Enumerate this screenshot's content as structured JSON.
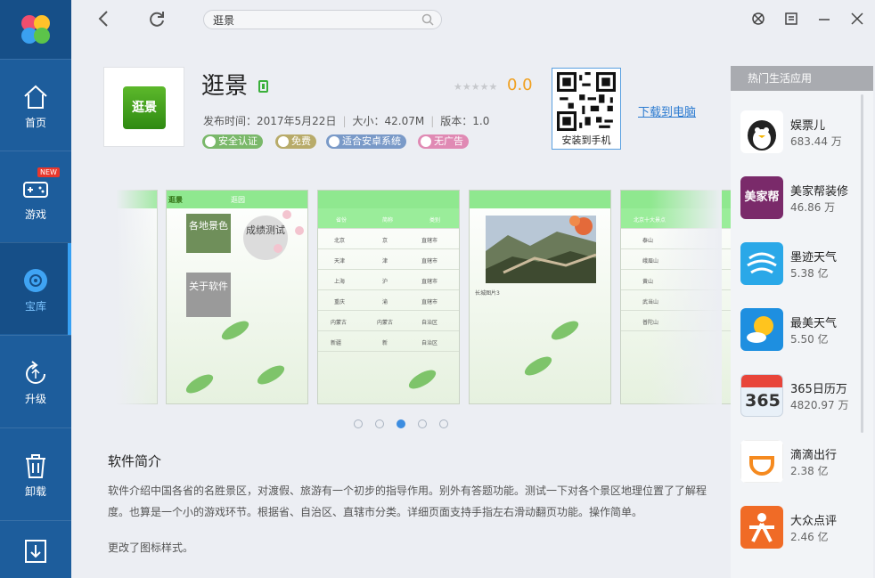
{
  "colors": {
    "sidebar": "#1d5d9c",
    "sidebar_active": "#164f88",
    "accent": "#3d8de0",
    "rating": "#f0a020",
    "link": "#2a7ad0"
  },
  "sidebar": {
    "items": [
      {
        "label": "首页",
        "icon": "home-icon"
      },
      {
        "label": "游戏",
        "icon": "gamepad-icon",
        "badge": "NEW"
      },
      {
        "label": "宝库",
        "icon": "disc-icon",
        "active": true
      },
      {
        "label": "升级",
        "icon": "upgrade-icon"
      },
      {
        "label": "卸载",
        "icon": "trash-icon"
      },
      {
        "label": "",
        "icon": "download-icon"
      }
    ]
  },
  "search": {
    "value": "逛景"
  },
  "app": {
    "name": "逛景",
    "icon_text": "逛景",
    "release": "发布时间：2017年5月22日",
    "size": "大小：42.07M",
    "version": "版本：1.0",
    "rating": "0.0",
    "stars": "★★★★★",
    "tags": [
      "安全认证",
      "免费",
      "适合安卓系统",
      "无广告"
    ],
    "qr_label": "安装到手机",
    "download_pc": "下载到电脑"
  },
  "screenshots": {
    "shot1": {
      "title": "逛园",
      "logo": "逛景",
      "buttons": [
        "各地景色",
        "成绩测试",
        "关于软件"
      ]
    },
    "shot2": {
      "headers": [
        "省份",
        "简称",
        "类别"
      ],
      "rows": [
        [
          "北京",
          "京",
          "直辖市"
        ],
        [
          "天津",
          "津",
          "直辖市"
        ],
        [
          "上海",
          "沪",
          "直辖市"
        ],
        [
          "重庆",
          "渝",
          "直辖市"
        ],
        [
          "内蒙古",
          "内蒙古",
          "自治区"
        ],
        [
          "新疆",
          "新",
          "自治区"
        ]
      ]
    },
    "shot3": {
      "caption": "长城图片3"
    },
    "shot4": {
      "header": "北京十大景点",
      "rows": [
        "泰山",
        "峨眉山",
        "黄山",
        "武当山",
        "普陀山"
      ]
    },
    "pager": {
      "count": 5,
      "active": 2
    }
  },
  "description": {
    "heading": "软件简介",
    "body": "软件介绍中国各省的名胜景区，对渡假、旅游有一个初步的指导作用。别外有答题功能。测试一下对各个景区地理位置了了解程度。也算是一个小的游戏环节。根据省、自治区、直辖市分类。详细页面支持手指左右滑动翻页功能。操作简单。",
    "extra": "更改了图标样式。"
  },
  "hot_apps": {
    "title": "热门生活应用",
    "items": [
      {
        "name": "娱票儿",
        "count": "683.44 万",
        "icon": "yupiaoer-penguin-icon",
        "color": "#ffffff"
      },
      {
        "name": "美家帮装修",
        "count": "46.86 万",
        "icon": "meijiabang-icon",
        "color": "#7a2a6a",
        "icon_text": "美家帮"
      },
      {
        "name": "墨迹天气",
        "count": "5.38 亿",
        "icon": "moji-weather-icon",
        "color": "#2aa8e8"
      },
      {
        "name": "最美天气",
        "count": "5.50 亿",
        "icon": "zuimei-weather-icon",
        "color": "#1e8fe0"
      },
      {
        "name": "365日历万",
        "count": "4820.97 万",
        "icon": "calendar-365-icon",
        "color": "#e8f0f8",
        "icon_text": "365"
      },
      {
        "name": "滴滴出行",
        "count": "2.38 亿",
        "icon": "didi-icon",
        "color": "#ffffff"
      },
      {
        "name": "大众点评",
        "count": "2.46 亿",
        "icon": "dianping-icon",
        "color": "#f06b26"
      }
    ]
  }
}
